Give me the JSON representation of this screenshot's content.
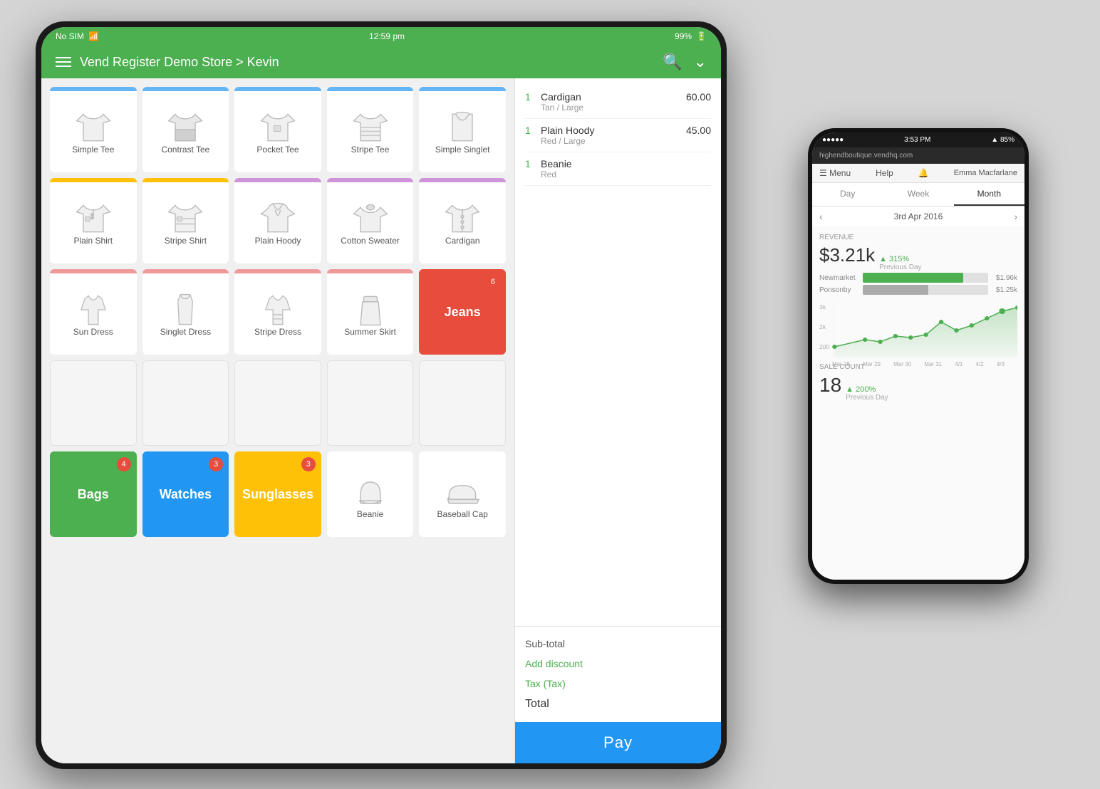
{
  "scene": {
    "bg": "#d0d0d0"
  },
  "tablet": {
    "status_bar": {
      "carrier": "No SIM",
      "wifi_icon": "📶",
      "time": "12:59 pm",
      "battery": "99%"
    },
    "header": {
      "title": "Vend Register Demo Store > Kevin",
      "search_icon": "🔍",
      "chevron_icon": "⌄"
    },
    "products": [
      [
        {
          "name": "Simple Tee",
          "color": "#64B5F6",
          "type": "tee"
        },
        {
          "name": "Contrast Tee",
          "color": "#64B5F6",
          "type": "tee2"
        },
        {
          "name": "Pocket Tee",
          "color": "#64B5F6",
          "type": "tee"
        },
        {
          "name": "Stripe Tee",
          "color": "#64B5F6",
          "type": "stripe-tee"
        },
        {
          "name": "Simple Singlet",
          "color": "#64B5F6",
          "type": "singlet"
        }
      ],
      [
        {
          "name": "Plain Shirt",
          "color": "#FFC107",
          "type": "shirt"
        },
        {
          "name": "Stripe Shirt",
          "color": "#FFC107",
          "type": "shirt"
        },
        {
          "name": "Plain Hoody",
          "color": "#CE93D8",
          "type": "hoody"
        },
        {
          "name": "Cotton Sweater",
          "color": "#CE93D8",
          "type": "sweater"
        },
        {
          "name": "Cardigan",
          "color": "#CE93D8",
          "type": "cardigan"
        }
      ],
      [
        {
          "name": "Sun Dress",
          "color": "#EF9A9A",
          "type": "dress"
        },
        {
          "name": "Singlet Dress",
          "color": "#EF9A9A",
          "type": "dress"
        },
        {
          "name": "Stripe Dress",
          "color": "#EF9A9A",
          "type": "dress"
        },
        {
          "name": "Summer Skirt",
          "color": "#EF9A9A",
          "type": "dress"
        },
        {
          "name": "Jeans",
          "color": "#e74c3c",
          "type": "colored",
          "badge": 6
        }
      ],
      [
        {
          "name": "",
          "type": "empty"
        },
        {
          "name": "",
          "type": "empty"
        },
        {
          "name": "",
          "type": "empty"
        },
        {
          "name": "",
          "type": "empty"
        },
        {
          "name": "",
          "type": "empty"
        }
      ],
      [
        {
          "name": "Bags",
          "color": "#4CAF50",
          "type": "colored-green",
          "badge": 4
        },
        {
          "name": "Watches",
          "color": "#2196F3",
          "type": "colored-blue",
          "badge": 3
        },
        {
          "name": "Sunglasses",
          "color": "#FFC107",
          "type": "colored-yellow",
          "badge": 3
        },
        {
          "name": "Beanie",
          "color": null,
          "type": "beanie"
        },
        {
          "name": "Baseball Cap",
          "color": null,
          "type": "cap"
        }
      ]
    ],
    "cart": {
      "items": [
        {
          "qty": 1,
          "name": "Cardigan",
          "variant": "Tan / Large",
          "price": "60.00"
        },
        {
          "qty": 1,
          "name": "Plain Hoody",
          "variant": "Red / Large",
          "price": "45.00"
        },
        {
          "qty": 1,
          "name": "Beanie",
          "variant": "Red",
          "price": ""
        }
      ],
      "subtotal_label": "Sub-total",
      "discount_label": "Add discount",
      "tax_label": "Tax (Tax)",
      "total_label": "Total",
      "pay_label": "Pay"
    }
  },
  "phone": {
    "status_bar": {
      "carrier": "●●●●●",
      "time": "3:53 PM",
      "signal": "▲ 85%"
    },
    "nav_url": "highendboutique.vendhq.com",
    "header": {
      "menu_label": "Menu",
      "help_label": "Help",
      "bell_label": "🔔",
      "user_label": "Emma Macfarlane"
    },
    "tabs": [
      "Day",
      "Week",
      "Month"
    ],
    "active_tab": "Month",
    "date": "3rd Apr 2016",
    "revenue_section_label": "REVENUE",
    "revenue_value": "$3.21k",
    "revenue_change": "▲ 315%",
    "revenue_change_label": "Previous Day",
    "bars": [
      {
        "label": "Newmarket",
        "value": "$1.96k",
        "pct": 80,
        "color": "green"
      },
      {
        "label": "Ponsonby",
        "value": "$1.25k",
        "pct": 52,
        "color": "gray"
      }
    ],
    "chart_labels": [
      "Mar 28",
      "Mar 29",
      "Mar 30",
      "Mar 31",
      "4/1",
      "4/2",
      "4/3"
    ],
    "chart_y_labels": [
      "3k",
      "2k",
      "200"
    ],
    "sale_count_label": "SALE COUNT",
    "sale_count_value": "18",
    "sale_count_change": "▲ 200%",
    "sale_count_change_label": "Previous Day"
  }
}
